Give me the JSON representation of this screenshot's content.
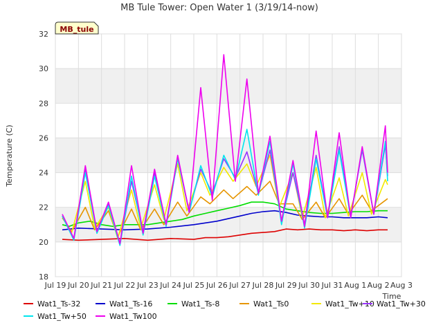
{
  "chart_data": {
    "type": "line",
    "title": "MB Tule Tower: Open Water 1 (3/19/14-now)",
    "ylabel": "Temperature (C)",
    "xlabel": "Time",
    "site_tag": "MB_tule",
    "ylim": [
      18,
      32
    ],
    "yticks": [
      18,
      20,
      22,
      24,
      26,
      28,
      30,
      32
    ],
    "xlim": [
      0,
      15
    ],
    "xticks": [
      {
        "x": 0,
        "label": "Jul 19"
      },
      {
        "x": 1,
        "label": "Jul 20"
      },
      {
        "x": 2,
        "label": "Jul 21"
      },
      {
        "x": 3,
        "label": "Jul 22"
      },
      {
        "x": 4,
        "label": "Jul 23"
      },
      {
        "x": 5,
        "label": "Jul 24"
      },
      {
        "x": 6,
        "label": "Jul 25"
      },
      {
        "x": 7,
        "label": "Jul 26"
      },
      {
        "x": 8,
        "label": "Jul 27"
      },
      {
        "x": 9,
        "label": "Jul 28"
      },
      {
        "x": 10,
        "label": "Jul 29"
      },
      {
        "x": 11,
        "label": "Jul 30"
      },
      {
        "x": 12,
        "label": "Jul 31"
      },
      {
        "x": 13,
        "label": "Aug 1"
      },
      {
        "x": 14,
        "label": "Aug 2"
      },
      {
        "x": 15,
        "label": "Aug 3"
      }
    ],
    "shaded_bands": [
      [
        20,
        22
      ],
      [
        24,
        26
      ],
      [
        28,
        30
      ]
    ],
    "grid": true,
    "legend_position": "bottom",
    "series": [
      {
        "name": "Wat1_Ts-32",
        "color": "#dd0000",
        "x": [
          0.3,
          1,
          2,
          3,
          4,
          5,
          6,
          6.5,
          7,
          7.5,
          8,
          8.5,
          9,
          9.5,
          10,
          10.5,
          11,
          11.5,
          12,
          12.5,
          13,
          13.5,
          14,
          14.4
        ],
        "y": [
          20.15,
          20.1,
          20.15,
          20.2,
          20.1,
          20.2,
          20.15,
          20.25,
          20.25,
          20.3,
          20.4,
          20.5,
          20.55,
          20.6,
          20.75,
          20.7,
          20.75,
          20.7,
          20.7,
          20.65,
          20.7,
          20.65,
          20.7,
          20.7
        ]
      },
      {
        "name": "Wat1_Ts-16",
        "color": "#0000cc",
        "x": [
          0.3,
          1,
          2,
          3,
          4,
          5,
          6,
          7,
          8,
          8.5,
          9,
          9.5,
          10,
          10.5,
          11,
          11.5,
          12,
          12.5,
          13,
          13.5,
          14,
          14.4
        ],
        "y": [
          20.7,
          20.8,
          20.75,
          20.7,
          20.75,
          20.85,
          21.0,
          21.2,
          21.5,
          21.65,
          21.75,
          21.8,
          21.7,
          21.55,
          21.5,
          21.45,
          21.45,
          21.4,
          21.4,
          21.4,
          21.45,
          21.4
        ]
      },
      {
        "name": "Wat1_Ts-8",
        "color": "#00dd00",
        "x": [
          0.3,
          0.6,
          1,
          1.5,
          2,
          2.5,
          3,
          3.5,
          4,
          4.5,
          5,
          5.5,
          6,
          6.5,
          7,
          7.5,
          8,
          8.5,
          9,
          9.5,
          10,
          10.5,
          11,
          11.5,
          12,
          12.5,
          13,
          13.5,
          14,
          14.4
        ],
        "y": [
          21.0,
          20.9,
          21.1,
          21.2,
          21.0,
          20.9,
          21.0,
          21.0,
          21.0,
          21.1,
          21.2,
          21.3,
          21.5,
          21.65,
          21.8,
          21.95,
          22.1,
          22.3,
          22.3,
          22.2,
          21.9,
          21.8,
          21.7,
          21.65,
          21.65,
          21.7,
          21.75,
          21.75,
          21.8,
          21.8
        ]
      },
      {
        "name": "Wat1_Ts0",
        "color": "#e69500",
        "x": [
          0.3,
          0.7,
          1.3,
          1.7,
          2.3,
          2.7,
          3.3,
          3.7,
          4.3,
          4.7,
          5.3,
          5.7,
          6.3,
          6.7,
          7.3,
          7.7,
          8.3,
          8.7,
          9.3,
          9.7,
          10.3,
          10.7,
          11.3,
          11.7,
          12.3,
          12.7,
          13.3,
          13.7,
          14.3,
          14.4
        ],
        "y": [
          21.4,
          20.6,
          22.0,
          20.7,
          21.8,
          20.3,
          21.9,
          20.7,
          21.9,
          21.0,
          22.3,
          21.5,
          22.6,
          22.2,
          23.0,
          22.5,
          23.2,
          22.7,
          23.5,
          22.2,
          22.2,
          21.3,
          22.3,
          21.4,
          22.5,
          21.6,
          22.7,
          21.8,
          22.4,
          22.5
        ]
      },
      {
        "name": "Wat1_Tw+10",
        "color": "#f2e800",
        "x": [
          0.3,
          0.7,
          1.3,
          1.7,
          2.3,
          2.7,
          3.3,
          3.7,
          4.3,
          4.7,
          5.3,
          5.7,
          6.3,
          6.7,
          7.3,
          7.7,
          8.3,
          8.7,
          9.3,
          9.7,
          10.3,
          10.7,
          11.3,
          11.7,
          12.3,
          12.7,
          13.3,
          13.7,
          14.3,
          14.4
        ],
        "y": [
          21.5,
          20.5,
          23.5,
          20.8,
          22.0,
          20.2,
          23.0,
          20.8,
          23.3,
          21.3,
          24.5,
          21.8,
          24.0,
          22.7,
          24.3,
          23.5,
          24.5,
          23.2,
          25.0,
          22.0,
          24.0,
          21.4,
          24.3,
          21.4,
          23.7,
          21.5,
          24.0,
          21.6,
          23.6,
          23.3
        ]
      },
      {
        "name": "Wat1_Tw+30",
        "color": "#9933ff",
        "x": [
          0.3,
          0.8,
          1.3,
          1.8,
          2.3,
          2.8,
          3.3,
          3.8,
          4.3,
          4.8,
          5.3,
          5.8,
          6.3,
          6.8,
          7.3,
          7.8,
          8.3,
          8.8,
          9.3,
          9.8,
          10.3,
          10.8,
          11.3,
          11.8,
          12.3,
          12.8,
          13.3,
          13.8,
          14.3,
          14.4
        ],
        "y": [
          21.5,
          20.2,
          24.2,
          20.6,
          22.2,
          19.9,
          23.5,
          20.6,
          24.0,
          21.0,
          24.8,
          21.8,
          24.2,
          22.8,
          24.8,
          23.7,
          25.2,
          22.8,
          25.3,
          21.2,
          24.0,
          21.0,
          25.0,
          21.5,
          25.5,
          21.5,
          25.3,
          21.6,
          25.6,
          23.8
        ]
      },
      {
        "name": "Wat1_Tw+50",
        "color": "#00e5ee",
        "x": [
          0.3,
          0.8,
          1.3,
          1.8,
          2.3,
          2.8,
          3.3,
          3.8,
          4.3,
          4.8,
          5.3,
          5.8,
          6.3,
          6.8,
          7.3,
          7.8,
          8.3,
          8.8,
          9.3,
          9.8,
          10.3,
          10.8,
          11.3,
          11.8,
          12.3,
          12.8,
          13.3,
          13.8,
          14.3,
          14.4
        ],
        "y": [
          21.5,
          20.1,
          24.0,
          20.5,
          22.1,
          19.8,
          23.8,
          20.4,
          23.8,
          20.9,
          24.8,
          21.7,
          24.4,
          22.6,
          25.0,
          23.6,
          26.5,
          22.7,
          25.8,
          21.0,
          24.5,
          20.8,
          24.8,
          21.4,
          25.3,
          21.4,
          25.4,
          21.6,
          25.8,
          23.5
        ]
      },
      {
        "name": "Wat1_Tw100",
        "color": "#ee00ee",
        "x": [
          0.3,
          0.8,
          1.3,
          1.8,
          2.3,
          2.8,
          3.3,
          3.8,
          4.3,
          4.8,
          5.3,
          5.8,
          6.3,
          6.8,
          7.3,
          7.8,
          8.3,
          8.8,
          9.3,
          9.8,
          10.3,
          10.8,
          11.3,
          11.8,
          12.3,
          12.8,
          13.3,
          13.8,
          14.3,
          14.4
        ],
        "y": [
          21.6,
          20.2,
          24.4,
          20.6,
          22.3,
          19.9,
          24.4,
          20.5,
          24.2,
          21.0,
          25.0,
          21.7,
          28.9,
          22.4,
          30.8,
          23.5,
          29.4,
          22.8,
          26.1,
          21.2,
          24.7,
          20.9,
          26.4,
          21.4,
          26.3,
          21.4,
          25.5,
          21.6,
          26.7,
          24.0
        ]
      }
    ]
  }
}
